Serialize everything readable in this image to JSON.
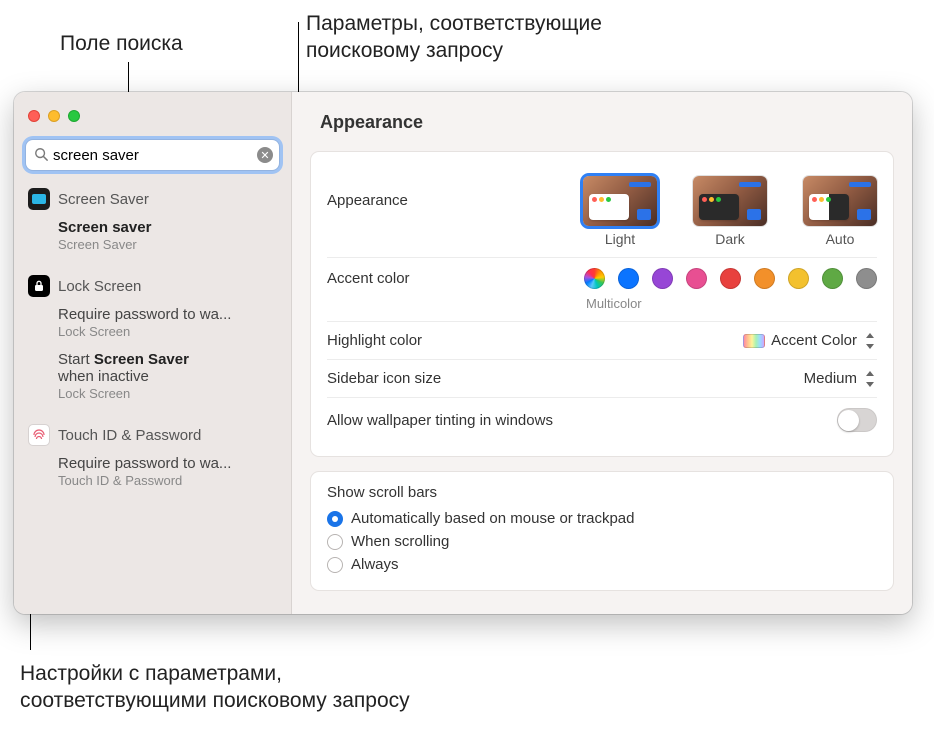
{
  "callouts": {
    "search_label": "Поле поиска",
    "results_label_l1": "Параметры, соответствующие",
    "results_label_l2": "поисковому запросу",
    "settings_label_l1": "Настройки с параметрами,",
    "settings_label_l2": "соответствующими поисковому запросу"
  },
  "search": {
    "value": "screen saver"
  },
  "sidebar": {
    "sections": [
      {
        "id": "screensaver",
        "title": "Screen Saver",
        "items": [
          {
            "title_plain": "Screen saver",
            "title_bold": "",
            "caption": "Screen Saver"
          }
        ]
      },
      {
        "id": "lockscreen",
        "title": "Lock Screen",
        "items": [
          {
            "title_plain": "Require password to wa...",
            "title_bold": "",
            "caption": "Lock Screen"
          },
          {
            "title_prefix": "Start ",
            "title_bold": "Screen Saver",
            "title_suffix_l1": "",
            "title_suffix_l2": "when inactive",
            "caption": "Lock Screen"
          }
        ]
      },
      {
        "id": "touchid",
        "title": "Touch ID & Password",
        "items": [
          {
            "title_plain": "Require password to wa...",
            "title_bold": "",
            "caption": "Touch ID & Password"
          }
        ]
      }
    ]
  },
  "content": {
    "title": "Appearance",
    "appearance": {
      "label": "Appearance",
      "options": [
        "Light",
        "Dark",
        "Auto"
      ],
      "selected": 0
    },
    "accent": {
      "label": "Accent color",
      "caption": "Multicolor",
      "colors": [
        "multicolor",
        "#0b74ff",
        "#9746d6",
        "#e84f92",
        "#e8413e",
        "#f2902a",
        "#f3c12e",
        "#5fa944",
        "#8e8e8e"
      ]
    },
    "highlight": {
      "label": "Highlight color",
      "value": "Accent Color"
    },
    "sidebar_icon": {
      "label": "Sidebar icon size",
      "value": "Medium"
    },
    "tinting": {
      "label": "Allow wallpaper tinting in windows",
      "on": false
    },
    "scrollbars": {
      "title": "Show scroll bars",
      "options": [
        "Automatically based on mouse or trackpad",
        "When scrolling",
        "Always"
      ],
      "selected": 0
    }
  }
}
